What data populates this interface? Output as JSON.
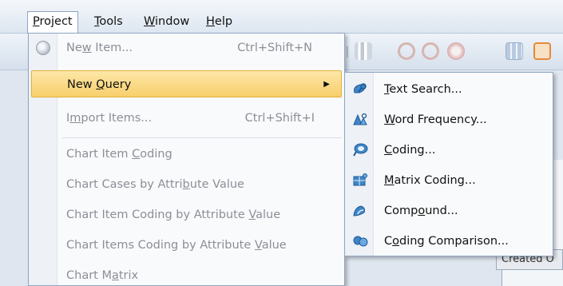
{
  "menubar": {
    "project": {
      "pre": "",
      "u": "P",
      "post": "roject"
    },
    "tools": {
      "pre": "",
      "u": "T",
      "post": "ools"
    },
    "window": {
      "pre": "",
      "u": "W",
      "post": "indow"
    },
    "help": {
      "pre": "",
      "u": "H",
      "post": "elp"
    }
  },
  "project_menu": {
    "new_item": {
      "pre": "Ne",
      "u": "w",
      "post": " Item...",
      "shortcut": "Ctrl+Shift+N"
    },
    "new_query": {
      "pre": "New ",
      "u": "Q",
      "post": "uery"
    },
    "import_items": {
      "pre": "I",
      "u": "m",
      "post": "port Items...",
      "shortcut": "Ctrl+Shift+I"
    },
    "chart_item_coding": {
      "pre": "Chart Item ",
      "u": "C",
      "post": "oding"
    },
    "chart_cases_attr": {
      "pre": "Chart Cases by Attri",
      "u": "b",
      "post": "ute Value"
    },
    "chart_item_coding_attr": {
      "pre": "Chart Item Coding by Attribute ",
      "u": "V",
      "post": "alue"
    },
    "chart_items_coding_attr": {
      "pre": "Chart Items Coding by Attribute ",
      "u": "V",
      "post": "alue"
    },
    "chart_matrix": {
      "pre": "Chart M",
      "u": "a",
      "post": "trix"
    }
  },
  "query_submenu": {
    "text_search": {
      "pre": "",
      "u": "T",
      "post": "ext Search..."
    },
    "word_frequency": {
      "pre": "",
      "u": "W",
      "post": "ord Frequency..."
    },
    "coding": {
      "pre": "",
      "u": "C",
      "post": "oding..."
    },
    "matrix_coding": {
      "pre": "",
      "u": "M",
      "post": "atrix Coding..."
    },
    "compound": {
      "pre": "Comp",
      "u": "o",
      "post": "und..."
    },
    "coding_comparison": {
      "pre": "C",
      "u": "o",
      "post": "ding Comparison..."
    }
  },
  "background": {
    "created_label": "Created O"
  },
  "icons": {
    "new_item": "new-item-icon",
    "text_search": "text-search-icon",
    "word_frequency": "word-frequency-icon",
    "coding": "coding-query-icon",
    "matrix_coding": "matrix-coding-icon",
    "compound": "compound-query-icon",
    "coding_comparison": "coding-comparison-icon"
  },
  "colors": {
    "highlight_top": "#fde7a9",
    "highlight_bottom": "#f8cf6b",
    "disabled_text": "#8b8f96",
    "menu_border": "#8ea6c2"
  }
}
